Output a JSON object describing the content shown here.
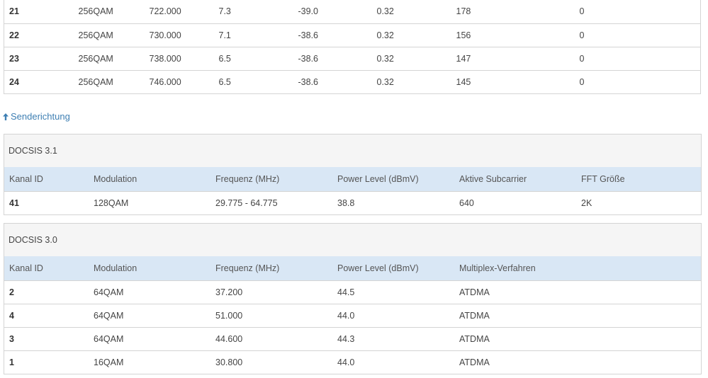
{
  "downstream_rows": [
    [
      "21",
      "256QAM",
      "722.000",
      "7.3",
      "-39.0",
      "0.32",
      "178",
      "0"
    ],
    [
      "22",
      "256QAM",
      "730.000",
      "7.1",
      "-38.6",
      "0.32",
      "156",
      "0"
    ],
    [
      "23",
      "256QAM",
      "738.000",
      "6.5",
      "-38.6",
      "0.32",
      "147",
      "0"
    ],
    [
      "24",
      "256QAM",
      "746.000",
      "6.5",
      "-38.6",
      "0.32",
      "145",
      "0"
    ]
  ],
  "upstream_link_label": "Senderichtung",
  "docsis31": {
    "title": "DOCSIS 3.1",
    "headers": [
      "Kanal ID",
      "Modulation",
      "Frequenz (MHz)",
      "Power Level (dBmV)",
      "Aktive Subcarrier",
      "FFT Größe"
    ],
    "rows": [
      [
        "41",
        "128QAM",
        "29.775 - 64.775",
        "38.8",
        "640",
        "2K"
      ]
    ]
  },
  "docsis30": {
    "title": "DOCSIS 3.0",
    "headers": [
      "Kanal ID",
      "Modulation",
      "Frequenz (MHz)",
      "Power Level (dBmV)",
      "Multiplex-Verfahren",
      ""
    ],
    "rows": [
      [
        "2",
        "64QAM",
        "37.200",
        "44.5",
        "ATDMA",
        ""
      ],
      [
        "4",
        "64QAM",
        "51.000",
        "44.0",
        "ATDMA",
        ""
      ],
      [
        "3",
        "64QAM",
        "44.600",
        "44.3",
        "ATDMA",
        ""
      ],
      [
        "1",
        "16QAM",
        "30.800",
        "44.0",
        "ATDMA",
        ""
      ]
    ]
  },
  "colors": {
    "link": "#3e7fb3",
    "header_row": "#d9e7f5",
    "panel_title_bg": "#f5f5f5",
    "border": "#d4d4d4"
  },
  "icons": {
    "direction": "arrow-up-icon"
  }
}
